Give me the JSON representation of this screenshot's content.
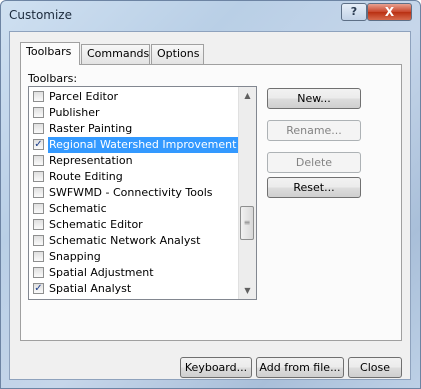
{
  "window": {
    "title": "Customize"
  },
  "titlebar_buttons": {
    "help": "?",
    "close": "X"
  },
  "tabs": [
    {
      "label": "Toolbars",
      "active": true
    },
    {
      "label": "Commands",
      "active": false
    },
    {
      "label": "Options",
      "active": false
    }
  ],
  "toolbars_label": "Toolbars:",
  "toolbar_items": [
    {
      "label": "Parcel Editor",
      "checked": false,
      "selected": false
    },
    {
      "label": "Publisher",
      "checked": false,
      "selected": false
    },
    {
      "label": "Raster Painting",
      "checked": false,
      "selected": false
    },
    {
      "label": "Regional Watershed Improvement Dec",
      "checked": true,
      "selected": true
    },
    {
      "label": "Representation",
      "checked": false,
      "selected": false
    },
    {
      "label": "Route Editing",
      "checked": false,
      "selected": false
    },
    {
      "label": "SWFWMD - Connectivity Tools",
      "checked": false,
      "selected": false
    },
    {
      "label": "Schematic",
      "checked": false,
      "selected": false
    },
    {
      "label": "Schematic Editor",
      "checked": false,
      "selected": false
    },
    {
      "label": "Schematic Network Analyst",
      "checked": false,
      "selected": false
    },
    {
      "label": "Snapping",
      "checked": false,
      "selected": false
    },
    {
      "label": "Spatial Adjustment",
      "checked": false,
      "selected": false
    },
    {
      "label": "Spatial Analyst",
      "checked": true,
      "selected": false
    }
  ],
  "side_buttons": {
    "new": "New...",
    "rename": "Rename...",
    "delete": "Delete",
    "reset": "Reset..."
  },
  "bottom_buttons": {
    "keyboard": "Keyboard...",
    "add_from_file": "Add from file...",
    "close": "Close"
  },
  "check_mark": "✓"
}
